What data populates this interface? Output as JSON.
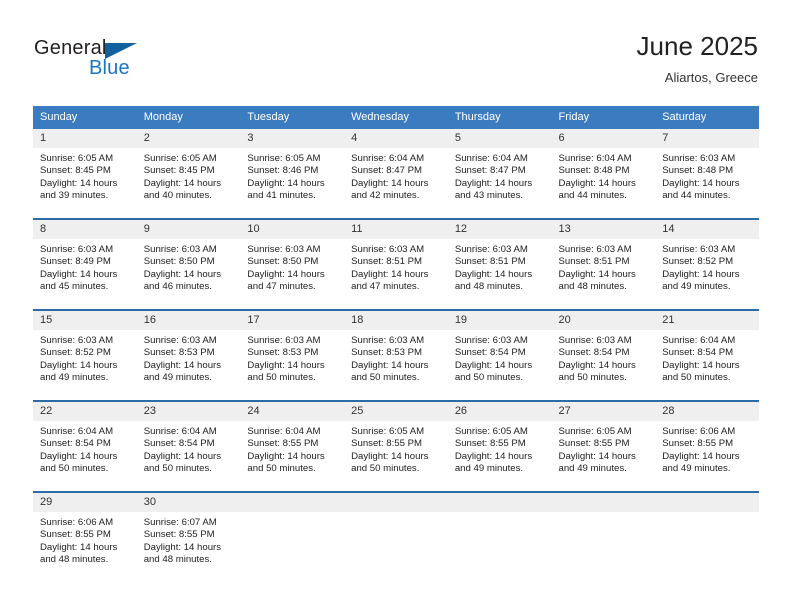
{
  "brand": {
    "name_top": "General",
    "name_bottom": "Blue",
    "triangle_icon": "triangle-icon",
    "color_dark": "#231f20",
    "color_blue": "#1a76c4"
  },
  "header": {
    "title": "June 2025",
    "subtitle": "Aliartos, Greece"
  },
  "colors": {
    "header_blue": "#3b7cc0",
    "row_rule_blue": "#2a6ba8",
    "daynum_band": "#efefef"
  },
  "weekday_headers": [
    "Sunday",
    "Monday",
    "Tuesday",
    "Wednesday",
    "Thursday",
    "Friday",
    "Saturday"
  ],
  "weeks": [
    [
      {
        "day": "1",
        "sunrise": "Sunrise: 6:05 AM",
        "sunset": "Sunset: 8:45 PM",
        "daylight": "Daylight: 14 hours and 39 minutes."
      },
      {
        "day": "2",
        "sunrise": "Sunrise: 6:05 AM",
        "sunset": "Sunset: 8:45 PM",
        "daylight": "Daylight: 14 hours and 40 minutes."
      },
      {
        "day": "3",
        "sunrise": "Sunrise: 6:05 AM",
        "sunset": "Sunset: 8:46 PM",
        "daylight": "Daylight: 14 hours and 41 minutes."
      },
      {
        "day": "4",
        "sunrise": "Sunrise: 6:04 AM",
        "sunset": "Sunset: 8:47 PM",
        "daylight": "Daylight: 14 hours and 42 minutes."
      },
      {
        "day": "5",
        "sunrise": "Sunrise: 6:04 AM",
        "sunset": "Sunset: 8:47 PM",
        "daylight": "Daylight: 14 hours and 43 minutes."
      },
      {
        "day": "6",
        "sunrise": "Sunrise: 6:04 AM",
        "sunset": "Sunset: 8:48 PM",
        "daylight": "Daylight: 14 hours and 44 minutes."
      },
      {
        "day": "7",
        "sunrise": "Sunrise: 6:03 AM",
        "sunset": "Sunset: 8:48 PM",
        "daylight": "Daylight: 14 hours and 44 minutes."
      }
    ],
    [
      {
        "day": "8",
        "sunrise": "Sunrise: 6:03 AM",
        "sunset": "Sunset: 8:49 PM",
        "daylight": "Daylight: 14 hours and 45 minutes."
      },
      {
        "day": "9",
        "sunrise": "Sunrise: 6:03 AM",
        "sunset": "Sunset: 8:50 PM",
        "daylight": "Daylight: 14 hours and 46 minutes."
      },
      {
        "day": "10",
        "sunrise": "Sunrise: 6:03 AM",
        "sunset": "Sunset: 8:50 PM",
        "daylight": "Daylight: 14 hours and 47 minutes."
      },
      {
        "day": "11",
        "sunrise": "Sunrise: 6:03 AM",
        "sunset": "Sunset: 8:51 PM",
        "daylight": "Daylight: 14 hours and 47 minutes."
      },
      {
        "day": "12",
        "sunrise": "Sunrise: 6:03 AM",
        "sunset": "Sunset: 8:51 PM",
        "daylight": "Daylight: 14 hours and 48 minutes."
      },
      {
        "day": "13",
        "sunrise": "Sunrise: 6:03 AM",
        "sunset": "Sunset: 8:51 PM",
        "daylight": "Daylight: 14 hours and 48 minutes."
      },
      {
        "day": "14",
        "sunrise": "Sunrise: 6:03 AM",
        "sunset": "Sunset: 8:52 PM",
        "daylight": "Daylight: 14 hours and 49 minutes."
      }
    ],
    [
      {
        "day": "15",
        "sunrise": "Sunrise: 6:03 AM",
        "sunset": "Sunset: 8:52 PM",
        "daylight": "Daylight: 14 hours and 49 minutes."
      },
      {
        "day": "16",
        "sunrise": "Sunrise: 6:03 AM",
        "sunset": "Sunset: 8:53 PM",
        "daylight": "Daylight: 14 hours and 49 minutes."
      },
      {
        "day": "17",
        "sunrise": "Sunrise: 6:03 AM",
        "sunset": "Sunset: 8:53 PM",
        "daylight": "Daylight: 14 hours and 50 minutes."
      },
      {
        "day": "18",
        "sunrise": "Sunrise: 6:03 AM",
        "sunset": "Sunset: 8:53 PM",
        "daylight": "Daylight: 14 hours and 50 minutes."
      },
      {
        "day": "19",
        "sunrise": "Sunrise: 6:03 AM",
        "sunset": "Sunset: 8:54 PM",
        "daylight": "Daylight: 14 hours and 50 minutes."
      },
      {
        "day": "20",
        "sunrise": "Sunrise: 6:03 AM",
        "sunset": "Sunset: 8:54 PM",
        "daylight": "Daylight: 14 hours and 50 minutes."
      },
      {
        "day": "21",
        "sunrise": "Sunrise: 6:04 AM",
        "sunset": "Sunset: 8:54 PM",
        "daylight": "Daylight: 14 hours and 50 minutes."
      }
    ],
    [
      {
        "day": "22",
        "sunrise": "Sunrise: 6:04 AM",
        "sunset": "Sunset: 8:54 PM",
        "daylight": "Daylight: 14 hours and 50 minutes."
      },
      {
        "day": "23",
        "sunrise": "Sunrise: 6:04 AM",
        "sunset": "Sunset: 8:54 PM",
        "daylight": "Daylight: 14 hours and 50 minutes."
      },
      {
        "day": "24",
        "sunrise": "Sunrise: 6:04 AM",
        "sunset": "Sunset: 8:55 PM",
        "daylight": "Daylight: 14 hours and 50 minutes."
      },
      {
        "day": "25",
        "sunrise": "Sunrise: 6:05 AM",
        "sunset": "Sunset: 8:55 PM",
        "daylight": "Daylight: 14 hours and 50 minutes."
      },
      {
        "day": "26",
        "sunrise": "Sunrise: 6:05 AM",
        "sunset": "Sunset: 8:55 PM",
        "daylight": "Daylight: 14 hours and 49 minutes."
      },
      {
        "day": "27",
        "sunrise": "Sunrise: 6:05 AM",
        "sunset": "Sunset: 8:55 PM",
        "daylight": "Daylight: 14 hours and 49 minutes."
      },
      {
        "day": "28",
        "sunrise": "Sunrise: 6:06 AM",
        "sunset": "Sunset: 8:55 PM",
        "daylight": "Daylight: 14 hours and 49 minutes."
      }
    ],
    [
      {
        "day": "29",
        "sunrise": "Sunrise: 6:06 AM",
        "sunset": "Sunset: 8:55 PM",
        "daylight": "Daylight: 14 hours and 48 minutes."
      },
      {
        "day": "30",
        "sunrise": "Sunrise: 6:07 AM",
        "sunset": "Sunset: 8:55 PM",
        "daylight": "Daylight: 14 hours and 48 minutes."
      },
      {
        "day": "",
        "sunrise": "",
        "sunset": "",
        "daylight": ""
      },
      {
        "day": "",
        "sunrise": "",
        "sunset": "",
        "daylight": ""
      },
      {
        "day": "",
        "sunrise": "",
        "sunset": "",
        "daylight": ""
      },
      {
        "day": "",
        "sunrise": "",
        "sunset": "",
        "daylight": ""
      },
      {
        "day": "",
        "sunrise": "",
        "sunset": "",
        "daylight": ""
      }
    ]
  ]
}
